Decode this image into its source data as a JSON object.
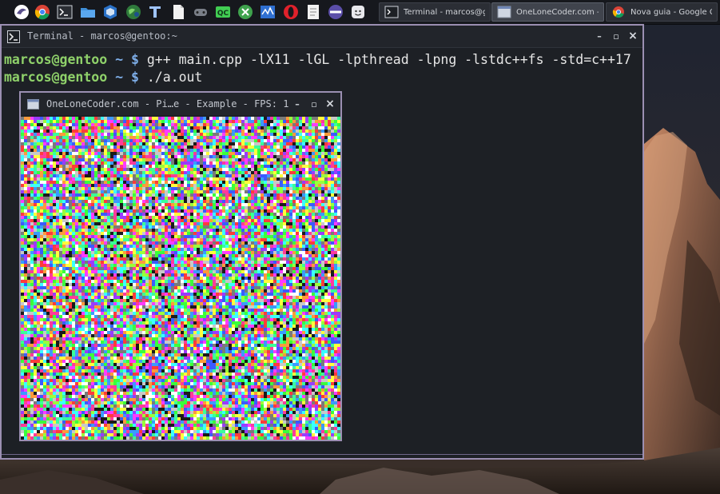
{
  "taskbar": {
    "launchers": [
      {
        "name": "linux-menu-icon"
      },
      {
        "name": "chrome-icon"
      },
      {
        "name": "terminal-launcher-icon"
      },
      {
        "name": "file-manager-icon"
      },
      {
        "name": "virtualbox-icon"
      },
      {
        "name": "globe-app-icon"
      },
      {
        "name": "text-editor-icon"
      },
      {
        "name": "document-icon"
      },
      {
        "name": "game-controller-icon"
      },
      {
        "name": "qt-creator-icon"
      },
      {
        "name": "xmpp-client-icon"
      },
      {
        "name": "system-monitor-icon"
      },
      {
        "name": "opera-icon"
      },
      {
        "name": "notes-icon"
      },
      {
        "name": "media-player-icon"
      },
      {
        "name": "messenger-icon"
      }
    ],
    "tasks": [
      {
        "label": "Terminal - marcos@g...",
        "icon": "terminal-icon",
        "active": false
      },
      {
        "label": "OneLoneCoder.com - ...",
        "icon": "window-icon",
        "active": true
      },
      {
        "label": "Nova guia - Google C...",
        "icon": "chrome-icon",
        "active": false
      }
    ]
  },
  "terminal": {
    "title": "Terminal - marcos@gentoo:~",
    "lines": [
      {
        "user": "marcos@gentoo",
        "cwd": "~",
        "symbol": "$",
        "command": "g++ main.cpp -lX11 -lGL -lpthread -lpng -lstdc++fs -std=c++17"
      },
      {
        "user": "marcos@gentoo",
        "cwd": "~",
        "symbol": "$",
        "command": "./a.out"
      }
    ],
    "buttons": {
      "minimize": "–",
      "maximize": "▫",
      "close": "×"
    }
  },
  "pge_window": {
    "title": "OneLoneCoder.com - Pi…e - Example - FPS: 1",
    "buttons": {
      "minimize": "–",
      "maximize": "▫",
      "close": "×"
    },
    "noise_palette": [
      "#1a1a1a",
      "#ffffff",
      "#ff3b3b",
      "#3bff3b",
      "#3b5bff",
      "#ffff3b",
      "#ff3bff",
      "#3bffff",
      "#ff9a3b",
      "#9a3bff",
      "#3bff9a",
      "#ff3b9a",
      "#9aff3b",
      "#3b9aff",
      "#c8c8c8",
      "#7a7a7a"
    ]
  },
  "colors": {
    "window_border": "#9b8fb2",
    "terminal_bg": "#1d2025",
    "prompt_user": "#8fd16a",
    "prompt_path": "#7eaee8"
  }
}
